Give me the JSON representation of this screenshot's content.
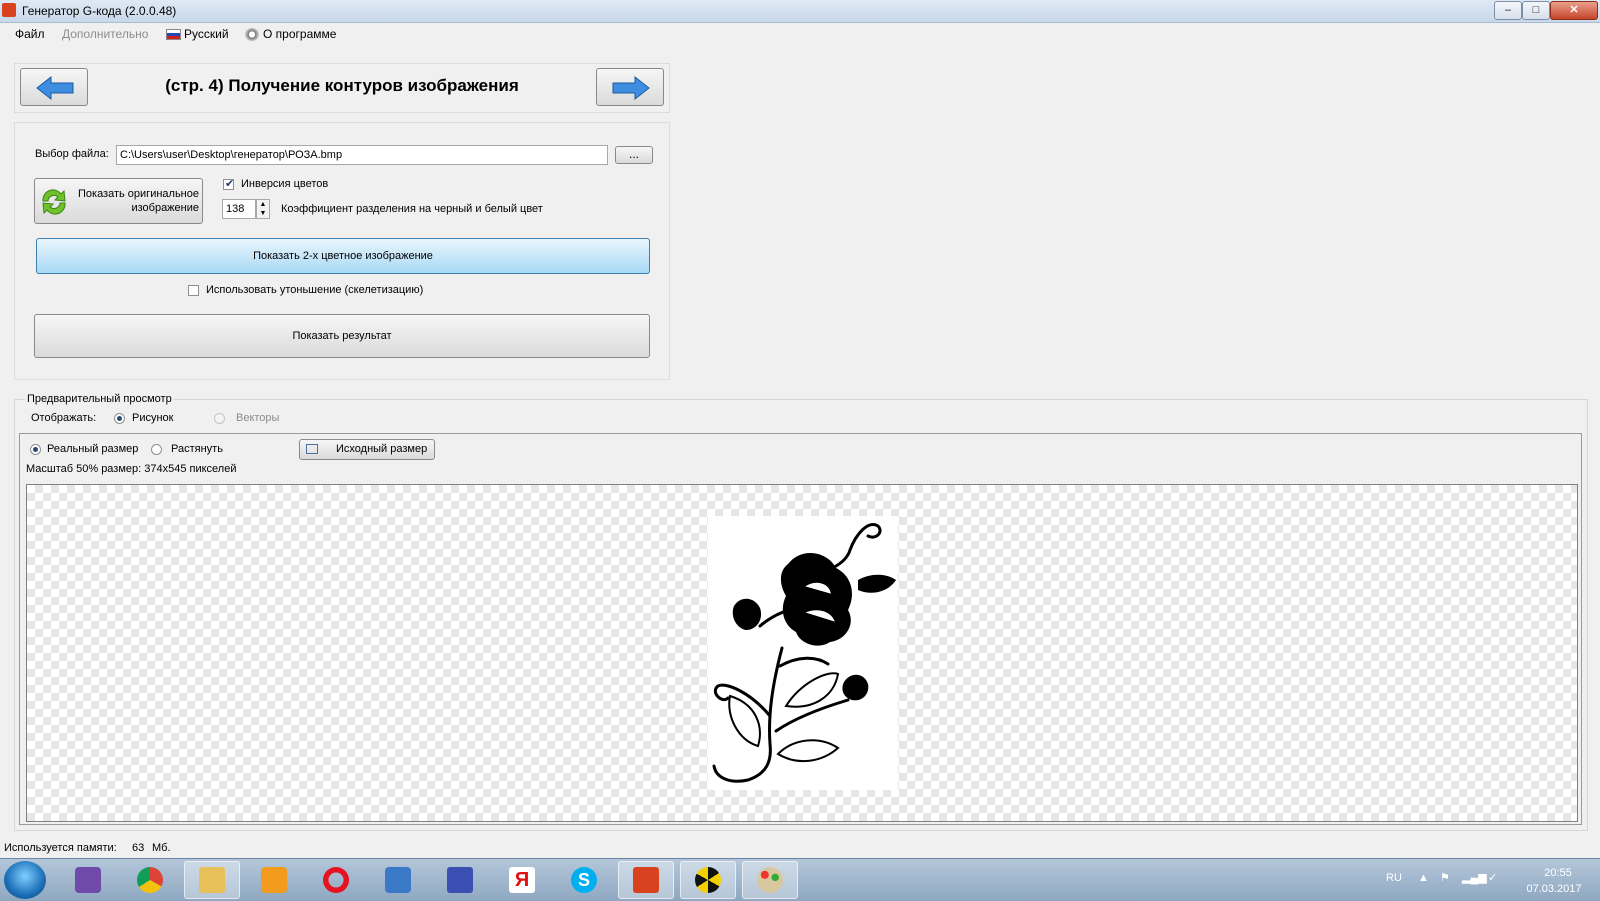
{
  "window": {
    "title": "Генератор G-кода (2.0.0.48)",
    "minimize": "‒",
    "maximize": "□",
    "close": "✕"
  },
  "menu": {
    "file": "Файл",
    "extra": "Дополнительно",
    "language": "Русский",
    "about": "О программе"
  },
  "step": {
    "title": "(стр. 4) Получение контуров изображения"
  },
  "file": {
    "label": "Выбор файла:",
    "path": "C:\\Users\\user\\Desktop\\генератор\\РОЗА.bmp",
    "browse": "..."
  },
  "controls": {
    "show_original": "Показать оригинальное изображение",
    "invert_label": "Инверсия цветов",
    "invert_checked": true,
    "threshold_value": "138",
    "threshold_label": "Коэффициент разделения на черный и белый цвет",
    "show_bw": "Показать 2-х цветное изображение",
    "skeleton_label": "Использовать утоньшение (скелетизацию)",
    "skeleton_checked": false,
    "show_result": "Показать результат"
  },
  "preview": {
    "group_label": "Предварительный просмотр",
    "display_label": "Отображать:",
    "option_picture": "Рисунок",
    "option_vectors": "Векторы",
    "real_size": "Реальный размер",
    "stretch": "Растянуть",
    "original_size_button": "Исходный размер",
    "scale_info": "Масштаб 50% размер: 374x545 пикселей"
  },
  "status": {
    "memory_label": "Используется памяти:",
    "memory_value": "63",
    "memory_unit": "Мб."
  },
  "taskbar": {
    "lang": "RU",
    "time": "20:55",
    "date": "07.03.2017",
    "apps": [
      "visual-studio",
      "chrome",
      "file-explorer",
      "media-player",
      "opera",
      "audio",
      "text-editor",
      "yandex",
      "skype",
      "gcode-generator",
      "radiation-app",
      "paint"
    ]
  }
}
